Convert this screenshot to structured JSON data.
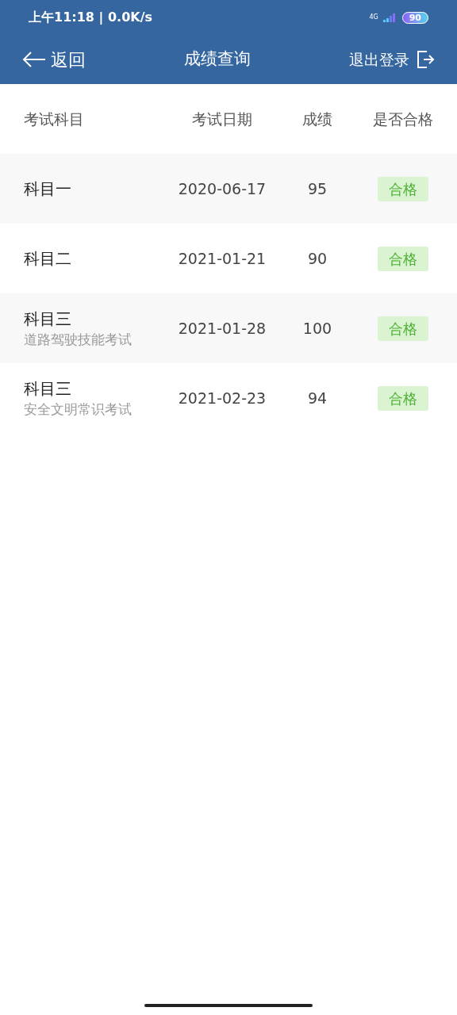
{
  "status_bar": {
    "time": "上午11:18 | 0.0K/s",
    "network": "4G",
    "battery": "90"
  },
  "nav": {
    "back": "返回",
    "title": "成绩查询",
    "logout": "退出登录"
  },
  "table": {
    "columns": [
      "考试科目",
      "考试日期",
      "成绩",
      "是否合格"
    ],
    "rows": [
      {
        "subject": "科目一",
        "date": "2020-06-17",
        "score": "95",
        "result": "合格",
        "passed": true
      },
      {
        "subject": "科目二",
        "date": "2021-01-21",
        "score": "90",
        "result": "合格",
        "passed": true
      },
      {
        "subject": "科目三",
        "note": "道路驾驶技能考试",
        "date": "2021-01-28",
        "score": "100",
        "result": "合格",
        "passed": true
      },
      {
        "subject": "科目三",
        "note": "安全文明常识考试",
        "date": "2021-02-23",
        "score": "94",
        "result": "合格",
        "passed": true
      }
    ]
  }
}
